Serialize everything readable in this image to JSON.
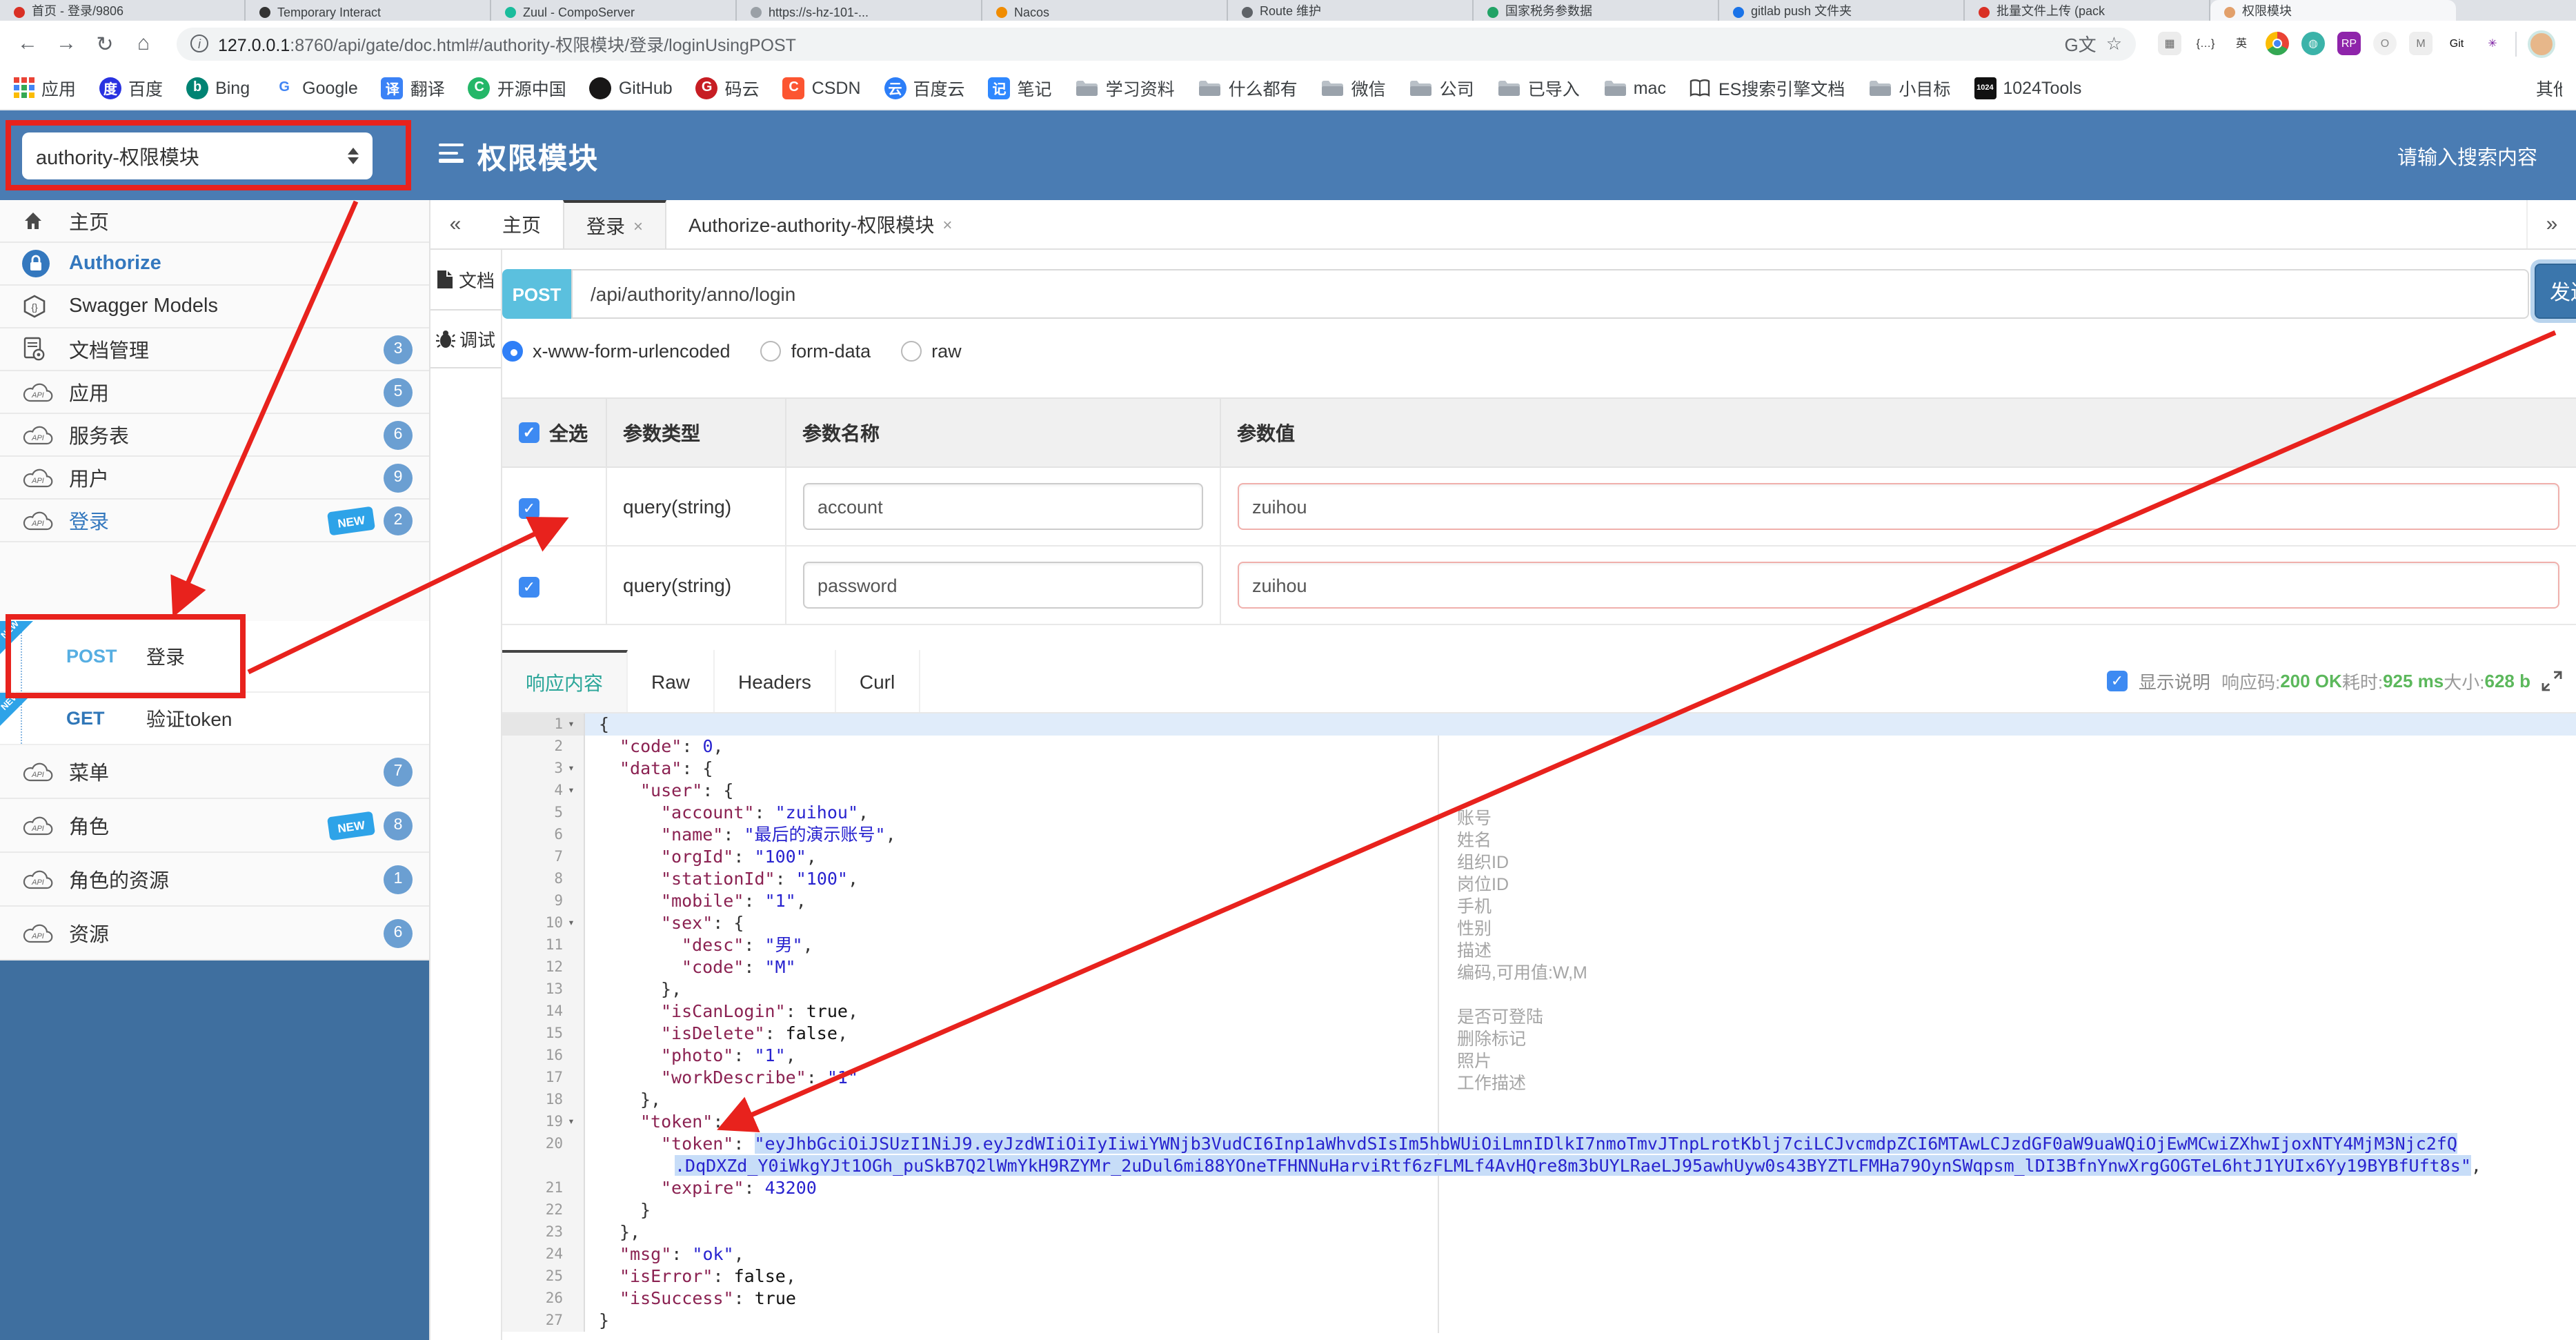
{
  "browser": {
    "tabs": [
      {
        "title": "首页 - 登录/9806",
        "favicon": "#d93025"
      },
      {
        "title": "Temporary Interact",
        "favicon": "#333333"
      },
      {
        "title": "Zuul - CompoServer",
        "favicon": "#1abc9c"
      },
      {
        "title": "https://s-hz-101-...",
        "favicon": "#9aa0a6"
      },
      {
        "title": "Nacos",
        "favicon": "#f08c00"
      },
      {
        "title": "Route 维护",
        "favicon": "#5f6368"
      },
      {
        "title": "国家税务参数据",
        "favicon": "#21a366"
      },
      {
        "title": "gitlab push 文件夹",
        "favicon": "#1a73e8"
      },
      {
        "title": "批量文件上传 (pack",
        "favicon": "#d93025"
      },
      {
        "title": "权限模块",
        "favicon": "#e2a06b",
        "active": true
      }
    ],
    "nav": [
      "back",
      "forward",
      "reload",
      "home"
    ],
    "url_host": "127.0.0.1",
    "url_rest": ":8760/api/gate/doc.html#/authority-权限模块/登录/loginUsingPOST",
    "extensions": [
      "scan",
      "braces",
      "translate-en",
      "chrome",
      "globe",
      "rp",
      "ring",
      "arrow-m",
      "gitzip",
      "asterisk"
    ],
    "bookmarks": [
      {
        "label": "应用",
        "icon": "grid"
      },
      {
        "label": "百度",
        "icon": "baidu"
      },
      {
        "label": "Bing",
        "icon": "bing"
      },
      {
        "label": "Google",
        "icon": "google"
      },
      {
        "label": "翻译",
        "icon": "trans"
      },
      {
        "label": "开源中国",
        "icon": "osc"
      },
      {
        "label": "GitHub",
        "icon": "github"
      },
      {
        "label": "码云",
        "icon": "gitee"
      },
      {
        "label": "CSDN",
        "icon": "csdn"
      },
      {
        "label": "百度云",
        "icon": "bcloud"
      },
      {
        "label": "笔记",
        "icon": "note"
      },
      {
        "label": "学习资料",
        "icon": "folder"
      },
      {
        "label": "什么都有",
        "icon": "folder"
      },
      {
        "label": "微信",
        "icon": "folder"
      },
      {
        "label": "公司",
        "icon": "folder"
      },
      {
        "label": "已导入",
        "icon": "folder"
      },
      {
        "label": "mac",
        "icon": "folder"
      },
      {
        "label": "ES搜索引擎文档",
        "icon": "book"
      },
      {
        "label": "小目标",
        "icon": "folder"
      },
      {
        "label": "1024Tools",
        "icon": "t1024"
      }
    ],
    "bookmarks_overflow": {
      "label": "其他书签",
      "icon": "folder"
    }
  },
  "header": {
    "module_select": "authority-权限模块",
    "title": "权限模块",
    "search_placeholder": "请输入搜索内容"
  },
  "sidebar": {
    "items": [
      {
        "type": "group",
        "icon": "home",
        "label": "主页"
      },
      {
        "type": "group",
        "icon": "lock",
        "label": "Authorize",
        "accent": true
      },
      {
        "type": "group",
        "icon": "models",
        "label": "Swagger Models"
      },
      {
        "type": "group",
        "icon": "docmgr",
        "label": "文档管理",
        "badge": "3"
      },
      {
        "type": "group",
        "icon": "api",
        "label": "应用",
        "badge": "5"
      },
      {
        "type": "group",
        "icon": "api",
        "label": "服务表",
        "badge": "6"
      },
      {
        "type": "group",
        "icon": "api",
        "label": "用户",
        "badge": "9"
      },
      {
        "type": "group",
        "icon": "api",
        "label": "登录",
        "badge": "2",
        "isNew": true,
        "accent2": true
      },
      {
        "type": "op",
        "method": "POST",
        "label": "登录",
        "isNew": true
      },
      {
        "type": "op",
        "method": "GET",
        "label": "验证token",
        "isNew": true
      },
      {
        "type": "group",
        "icon": "api",
        "label": "菜单",
        "badge": "7"
      },
      {
        "type": "group",
        "icon": "api",
        "label": "角色",
        "badge": "8",
        "isNew": true
      },
      {
        "type": "group",
        "icon": "api",
        "label": "角色的资源",
        "badge": "1"
      },
      {
        "type": "group",
        "icon": "api",
        "label": "资源",
        "badge": "6"
      }
    ]
  },
  "main": {
    "collapse_glyph": "«",
    "more_glyph": "»",
    "close_glyph": "×",
    "tabs": [
      {
        "label": "主页",
        "closable": false
      },
      {
        "label": "登录",
        "closable": true,
        "active": true
      },
      {
        "label": "Authorize-authority-权限模块",
        "closable": true
      }
    ],
    "side_tabs": [
      {
        "label": "文档",
        "icon": "doc"
      },
      {
        "label": "调试",
        "icon": "bug",
        "active": true
      }
    ],
    "request": {
      "method": "POST",
      "path": "/api/authority/anno/login",
      "send_label": "发送",
      "content_types": [
        {
          "label": "x-www-form-urlencoded",
          "selected": true
        },
        {
          "label": "form-data",
          "selected": false
        },
        {
          "label": "raw",
          "selected": false
        }
      ]
    },
    "params": {
      "select_all": "全选",
      "headers": [
        "参数类型",
        "参数名称",
        "参数值"
      ],
      "rows": [
        {
          "checked": true,
          "type": "query(string)",
          "name": "account",
          "value": "zuihou"
        },
        {
          "checked": true,
          "type": "query(string)",
          "name": "password",
          "value": "zuihou"
        }
      ]
    },
    "response": {
      "tabs": [
        {
          "label": "响应内容",
          "active": true
        },
        {
          "label": "Raw"
        },
        {
          "label": "Headers"
        },
        {
          "label": "Curl"
        }
      ],
      "show_desc": "显示说明",
      "show_desc_checked": true,
      "status": [
        {
          "label": "响应码:",
          "value": "200 OK"
        },
        {
          "label": "耗时:",
          "value": "925 ms"
        },
        {
          "label": "大小:",
          "value": "628 b"
        }
      ]
    }
  },
  "code": {
    "lines": [
      {
        "n": 1,
        "fold": true,
        "ind": 0,
        "active": true,
        "segs": [
          [
            "p",
            "{"
          ]
        ]
      },
      {
        "n": 2,
        "ind": 1,
        "segs": [
          [
            "k",
            "\"code\""
          ],
          [
            "p",
            ": "
          ],
          [
            "n",
            "0"
          ],
          [
            "p",
            ","
          ]
        ]
      },
      {
        "n": 3,
        "fold": true,
        "ind": 1,
        "segs": [
          [
            "k",
            "\"data\""
          ],
          [
            "p",
            ": {"
          ]
        ]
      },
      {
        "n": 4,
        "fold": true,
        "ind": 2,
        "segs": [
          [
            "k",
            "\"user\""
          ],
          [
            "p",
            ": {"
          ]
        ]
      },
      {
        "n": 5,
        "ind": 3,
        "segs": [
          [
            "k",
            "\"account\""
          ],
          [
            "p",
            ": "
          ],
          [
            "s",
            "\"zuihou\""
          ],
          [
            "p",
            ","
          ]
        ]
      },
      {
        "n": 6,
        "ind": 3,
        "segs": [
          [
            "k",
            "\"name\""
          ],
          [
            "p",
            ": "
          ],
          [
            "s",
            "\"最后的演示账号\""
          ],
          [
            "p",
            ","
          ]
        ]
      },
      {
        "n": 7,
        "ind": 3,
        "segs": [
          [
            "k",
            "\"orgId\""
          ],
          [
            "p",
            ": "
          ],
          [
            "s",
            "\"100\""
          ],
          [
            "p",
            ","
          ]
        ]
      },
      {
        "n": 8,
        "ind": 3,
        "segs": [
          [
            "k",
            "\"stationId\""
          ],
          [
            "p",
            ": "
          ],
          [
            "s",
            "\"100\""
          ],
          [
            "p",
            ","
          ]
        ]
      },
      {
        "n": 9,
        "ind": 3,
        "segs": [
          [
            "k",
            "\"mobile\""
          ],
          [
            "p",
            ": "
          ],
          [
            "s",
            "\"1\""
          ],
          [
            "p",
            ","
          ]
        ]
      },
      {
        "n": 10,
        "fold": true,
        "ind": 3,
        "segs": [
          [
            "k",
            "\"sex\""
          ],
          [
            "p",
            ": {"
          ]
        ]
      },
      {
        "n": 11,
        "ind": 4,
        "segs": [
          [
            "k",
            "\"desc\""
          ],
          [
            "p",
            ": "
          ],
          [
            "s",
            "\"男\""
          ],
          [
            "p",
            ","
          ]
        ]
      },
      {
        "n": 12,
        "ind": 4,
        "segs": [
          [
            "k",
            "\"code\""
          ],
          [
            "p",
            ": "
          ],
          [
            "s",
            "\"M\""
          ]
        ]
      },
      {
        "n": 13,
        "ind": 3,
        "segs": [
          [
            "p",
            "},"
          ]
        ]
      },
      {
        "n": 14,
        "ind": 3,
        "segs": [
          [
            "k",
            "\"isCanLogin\""
          ],
          [
            "p",
            ": "
          ],
          [
            "b",
            "true"
          ],
          [
            "p",
            ","
          ]
        ]
      },
      {
        "n": 15,
        "ind": 3,
        "segs": [
          [
            "k",
            "\"isDelete\""
          ],
          [
            "p",
            ": "
          ],
          [
            "b",
            "false"
          ],
          [
            "p",
            ","
          ]
        ]
      },
      {
        "n": 16,
        "ind": 3,
        "segs": [
          [
            "k",
            "\"photo\""
          ],
          [
            "p",
            ": "
          ],
          [
            "s",
            "\"1\""
          ],
          [
            "p",
            ","
          ]
        ]
      },
      {
        "n": 17,
        "ind": 3,
        "segs": [
          [
            "k",
            "\"workDescribe\""
          ],
          [
            "p",
            ": "
          ],
          [
            "s",
            "\"1\""
          ]
        ]
      },
      {
        "n": 18,
        "ind": 2,
        "segs": [
          [
            "p",
            "},"
          ]
        ]
      },
      {
        "n": 19,
        "fold": true,
        "ind": 2,
        "segs": [
          [
            "k",
            "\"token\""
          ],
          [
            "p",
            ": {"
          ]
        ]
      },
      {
        "n": 20,
        "ind": 3,
        "segs": [
          [
            "k",
            "\"token\""
          ],
          [
            "p",
            ": "
          ],
          [
            "st",
            "\"eyJhbGciOiJSUzI1NiJ9.eyJzdWIiOiIyIiwiYWNjb3VudCI6Inp1aWhvdSIsIm5hbWUiOiLmnIDlkI7nmoTmvJTnpLrotKblj7ciLCJvcmdpZCI6MTAwLCJzdGF0aW9uaWQiOjEwMCwiZXhwIjoxNTY4MjM3Njc2fQ"
          ]
        ]
      },
      {
        "wrap": true,
        "pad": 55,
        "segs": [
          [
            "st",
            ".DqDXZd_Y0iWkgYJt1OGh_puSkB7Q2lWmYkH9RZYMr_2uDul6mi88YOneTFHNNuHarviRtf6zFLMLf4AvHQre8m3bUYLRaeLJ95awhUyw0s43BYZTLFMHa79OynSWqpsm_lDI3BfnYnwXrgGOGTeL6htJ1YUIx6Yy19BYBfUft8s\""
          ],
          [
            "p",
            ","
          ]
        ]
      },
      {
        "n": 21,
        "ind": 3,
        "segs": [
          [
            "k",
            "\"expire\""
          ],
          [
            "p",
            ": "
          ],
          [
            "n",
            "43200"
          ]
        ]
      },
      {
        "n": 22,
        "ind": 2,
        "segs": [
          [
            "p",
            "}"
          ]
        ]
      },
      {
        "n": 23,
        "ind": 1,
        "segs": [
          [
            "p",
            "},"
          ]
        ]
      },
      {
        "n": 24,
        "ind": 1,
        "segs": [
          [
            "k",
            "\"msg\""
          ],
          [
            "p",
            ": "
          ],
          [
            "s",
            "\"ok\""
          ],
          [
            "p",
            ","
          ]
        ]
      },
      {
        "n": 25,
        "ind": 1,
        "segs": [
          [
            "k",
            "\"isError\""
          ],
          [
            "p",
            ": "
          ],
          [
            "b",
            "false"
          ],
          [
            "p",
            ","
          ]
        ]
      },
      {
        "n": 26,
        "ind": 1,
        "segs": [
          [
            "k",
            "\"isSuccess\""
          ],
          [
            "p",
            ": "
          ],
          [
            "b",
            "true"
          ]
        ]
      },
      {
        "n": 27,
        "ind": 0,
        "segs": [
          [
            "p",
            "}"
          ]
        ]
      }
    ],
    "annotations": [
      {
        "line": 5,
        "text": "账号"
      },
      {
        "line": 6,
        "text": "姓名"
      },
      {
        "line": 7,
        "text": "组织ID"
      },
      {
        "line": 8,
        "text": "岗位ID"
      },
      {
        "line": 9,
        "text": "手机"
      },
      {
        "line": 10,
        "text": "性别"
      },
      {
        "line": 11,
        "text": "描述"
      },
      {
        "line": 12,
        "text": "编码,可用值:W,M"
      },
      {
        "line": 14,
        "text": "是否可登陆"
      },
      {
        "line": 15,
        "text": "删除标记"
      },
      {
        "line": 16,
        "text": "照片"
      },
      {
        "line": 17,
        "text": "工作描述"
      }
    ]
  }
}
